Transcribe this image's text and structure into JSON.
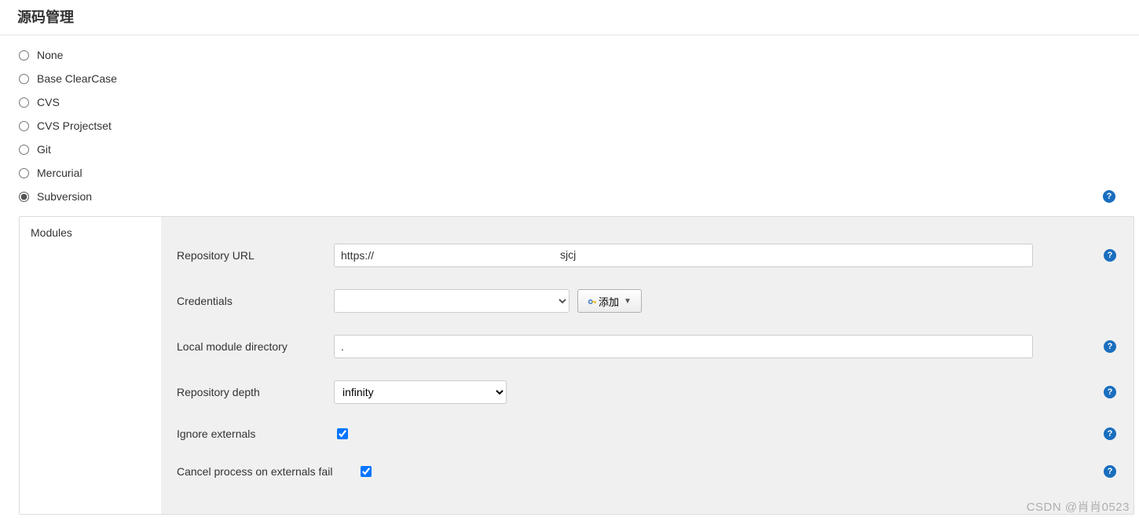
{
  "section": {
    "title": "源码管理"
  },
  "scm": {
    "options": [
      {
        "id": "none",
        "label": "None"
      },
      {
        "id": "clearcase",
        "label": "Base ClearCase"
      },
      {
        "id": "cvs",
        "label": "CVS"
      },
      {
        "id": "cvsproj",
        "label": "CVS Projectset"
      },
      {
        "id": "git",
        "label": "Git"
      },
      {
        "id": "mercurial",
        "label": "Mercurial"
      },
      {
        "id": "subversion",
        "label": "Subversion"
      }
    ],
    "selected": "subversion"
  },
  "modules": {
    "tab_label": "Modules",
    "repo_url": {
      "label": "Repository URL",
      "value_prefix": "https://",
      "value_suffix": "sjcj"
    },
    "credentials": {
      "label": "Credentials",
      "selected_display": " ",
      "add_button": "添加"
    },
    "local_dir": {
      "label": "Local module directory",
      "value": "."
    },
    "depth": {
      "label": "Repository depth",
      "value": "infinity"
    },
    "ignore_externals": {
      "label": "Ignore externals",
      "checked": true
    },
    "cancel_on_fail": {
      "label": "Cancel process on externals fail",
      "checked": true
    }
  },
  "watermark": "CSDN @肖肖0523"
}
